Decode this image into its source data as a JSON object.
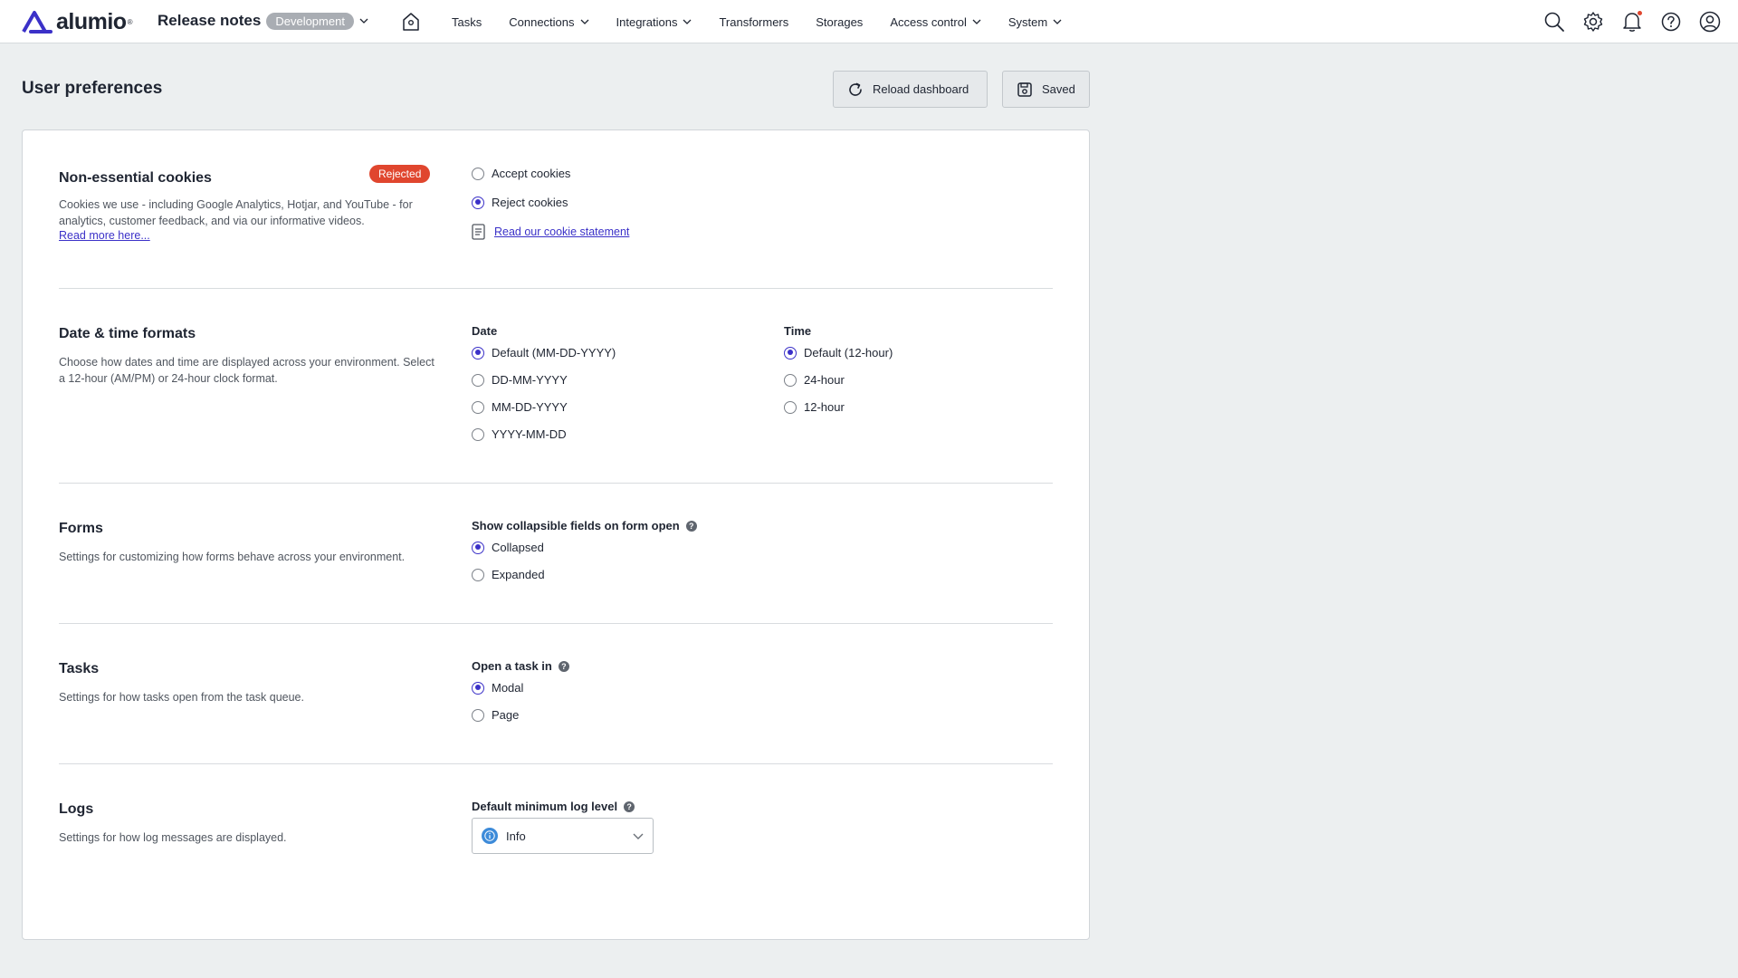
{
  "app": {
    "logo_text": "alumio",
    "logo_tm": "®",
    "project_title": "Release notes",
    "environment": "Development"
  },
  "nav": {
    "items": [
      {
        "label": "Tasks",
        "has_dropdown": false
      },
      {
        "label": "Connections",
        "has_dropdown": true
      },
      {
        "label": "Integrations",
        "has_dropdown": true
      },
      {
        "label": "Transformers",
        "has_dropdown": false
      },
      {
        "label": "Storages",
        "has_dropdown": false
      },
      {
        "label": "Access control",
        "has_dropdown": true
      },
      {
        "label": "System",
        "has_dropdown": true
      }
    ],
    "icons": [
      "search-icon",
      "gear-icon",
      "bell-icon",
      "help-icon",
      "user-icon"
    ]
  },
  "header": {
    "title": "User preferences",
    "reload_label": "Reload dashboard",
    "saved_label": "Saved"
  },
  "cookies": {
    "title": "Non-essential cookies",
    "badge": "Rejected",
    "description": "Cookies we use - including Google Analytics, Hotjar, and YouTube - for analytics, customer feedback, and via our informative videos.",
    "read_more": "Read more here...",
    "options": [
      {
        "label": "Accept cookies",
        "selected": false
      },
      {
        "label": "Reject cookies",
        "selected": true
      }
    ],
    "statement_link": "Read our cookie statement"
  },
  "datetime": {
    "title": "Date & time formats",
    "description": "Choose how dates and time are displayed across your environment. Select a 12-hour (AM/PM) or 24-hour clock format.",
    "date_label": "Date",
    "date_options": [
      {
        "label": "Default (MM-DD-YYYY)",
        "selected": true
      },
      {
        "label": "DD-MM-YYYY",
        "selected": false
      },
      {
        "label": "MM-DD-YYYY",
        "selected": false
      },
      {
        "label": "YYYY-MM-DD",
        "selected": false
      }
    ],
    "time_label": "Time",
    "time_options": [
      {
        "label": "Default (12-hour)",
        "selected": true
      },
      {
        "label": "24-hour",
        "selected": false
      },
      {
        "label": "12-hour",
        "selected": false
      }
    ]
  },
  "forms": {
    "title": "Forms",
    "description": "Settings for customizing how forms behave across your environment.",
    "group_label": "Show collapsible fields on form open",
    "options": [
      {
        "label": "Collapsed",
        "selected": true
      },
      {
        "label": "Expanded",
        "selected": false
      }
    ]
  },
  "tasks": {
    "title": "Tasks",
    "description": "Settings for how tasks open from the task queue.",
    "group_label": "Open a task in",
    "options": [
      {
        "label": "Modal",
        "selected": true
      },
      {
        "label": "Page",
        "selected": false
      }
    ]
  },
  "logs": {
    "title": "Logs",
    "description": "Settings for how log messages are displayed.",
    "group_label": "Default minimum log level",
    "selected_level": "Info"
  },
  "colors": {
    "accent": "#3b31c8",
    "rejected": "#e0462e",
    "info": "#3d8bd9"
  }
}
